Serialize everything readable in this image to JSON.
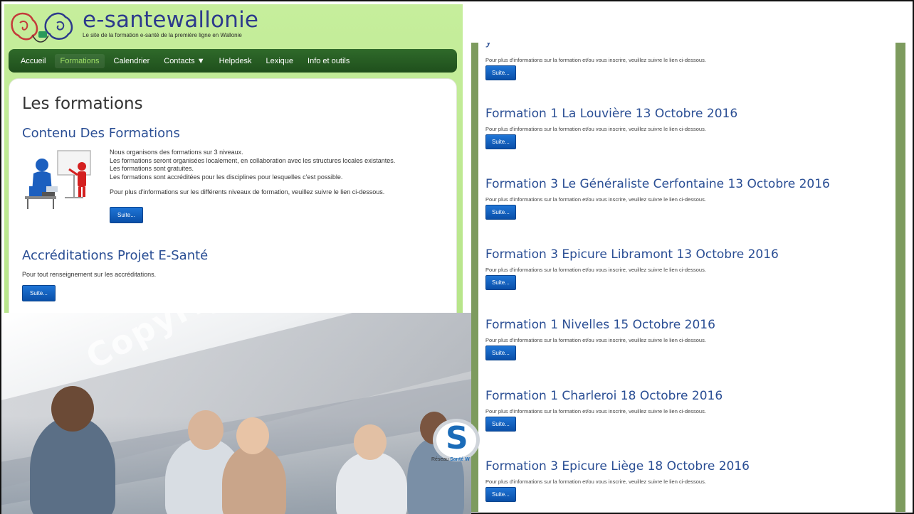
{
  "watermark": "Copyright e-sa",
  "s_logo": {
    "letter": "S",
    "tag_prefix": "Réseau ",
    "tag_brand": "Santé W"
  },
  "left": {
    "site_name": "e-santewallonie",
    "tagline": "Le site de la formation e-santé de la première ligne en Wallonie",
    "nav": [
      {
        "label": "Accueil",
        "active": false
      },
      {
        "label": "Formations",
        "active": true
      },
      {
        "label": "Calendrier",
        "active": false
      },
      {
        "label": "Contacts ▼",
        "active": false
      },
      {
        "label": "Helpdesk",
        "active": false
      },
      {
        "label": "Lexique",
        "active": false
      },
      {
        "label": "Info et outils",
        "active": false
      }
    ],
    "page_title": "Les formations",
    "section1": {
      "title": "Contenu Des Formations",
      "lines": [
        "Nous organisons des formations sur 3 niveaux.",
        "Les formations seront organisées localement, en collaboration avec les structures locales existantes.",
        "Les formations sont gratuites.",
        "Les formations sont accréditées pour les disciplines pour lesquelles c'est possible."
      ],
      "more": "Pour plus d'informations sur les différents niveaux de formation, veuillez suivre le lien ci-dessous.",
      "button": "Suite..."
    },
    "section2": {
      "title": "Accréditations Projet E-Santé",
      "text": "Pour tout renseignement sur les accréditations.",
      "button": "Suite..."
    }
  },
  "right": {
    "info_text": "Pour plus d'informations sur la formation et/ou vous inscrire, veuillez suivre le lien ci-dessous.",
    "button": "Suite...",
    "items": [
      {
        "title": "Formation 1 La Louvière 13 Octobre 2016"
      },
      {
        "title": "Formation 3 Le Généraliste Cerfontaine 13 Octobre 2016"
      },
      {
        "title": "Formation 3 Epicure Libramont 13 Octobre 2016"
      },
      {
        "title": "Formation 1 Nivelles 15 Octobre 2016"
      },
      {
        "title": "Formation 1 Charleroi 18 Octobre 2016"
      },
      {
        "title": "Formation 3 Epicure Liège 18 Octobre 2016"
      }
    ]
  }
}
